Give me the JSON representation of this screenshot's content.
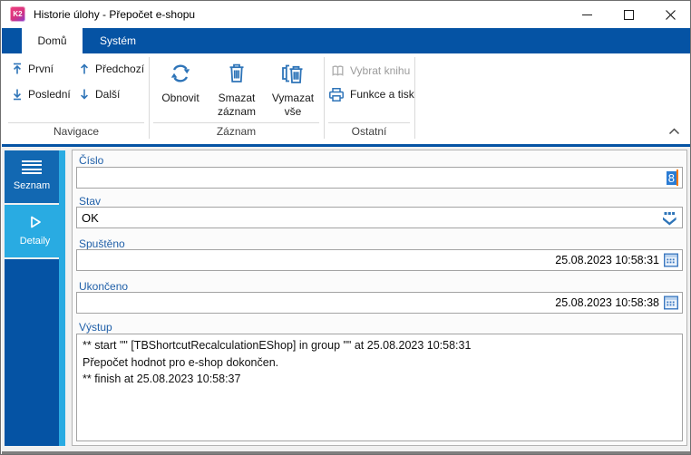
{
  "window": {
    "title": "Historie úlohy - Přepočet e-shopu",
    "logo_text": "K2"
  },
  "ribbon": {
    "tabs": {
      "home": "Domů",
      "system": "Systém"
    },
    "nav_group": {
      "label": "Navigace",
      "first": "První",
      "previous": "Předchozí",
      "last": "Poslední",
      "next": "Další"
    },
    "record_group": {
      "label": "Záznam",
      "refresh": "Obnovit",
      "delete_record": "Smazat\nzáznam",
      "clear_all": "Vymazat\nvše"
    },
    "other_group": {
      "label": "Ostatní",
      "select_book": "Vybrat knihu",
      "functions_print": "Funkce a tisk"
    }
  },
  "sidebar": {
    "list_label": "Seznam",
    "details_label": "Detaily"
  },
  "form": {
    "number": {
      "label": "Číslo",
      "value": "8"
    },
    "status": {
      "label": "Stav",
      "value": "OK"
    },
    "started": {
      "label": "Spuštěno",
      "value": "25.08.2023 10:58:31"
    },
    "finished": {
      "label": "Ukončeno",
      "value": "25.08.2023 10:58:38"
    },
    "output": {
      "label": "Výstup",
      "lines": [
        "** start \"\" [TBShortcutRecalculationEShop] in group \"\" at 25.08.2023 10:58:31",
        "Přepočet hodnot pro e-shop dokončen.",
        "** finish at 25.08.2023 10:58:37"
      ]
    }
  },
  "colors": {
    "ribbon_blue": "#0553a4",
    "accent_cyan": "#29abe2",
    "sidebar_item_blue": "#1268b2",
    "label_blue": "#1f5fa8",
    "icon_blue": "#2e74b8",
    "selection_blue": "#2b7cd4",
    "caret_orange": "#ff7a00",
    "disabled_gray": "#9b9b9b"
  }
}
